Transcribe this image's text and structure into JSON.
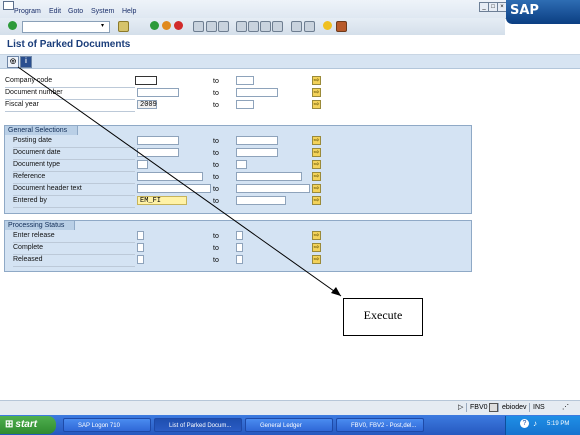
{
  "menu": [
    "Program",
    "Edit",
    "Goto",
    "System",
    "Help"
  ],
  "brand": "SAP",
  "page_title": "List of Parked Documents",
  "top_fields": [
    {
      "label": "Company code",
      "from": "",
      "to_label": "to",
      "to": ""
    },
    {
      "label": "Document number",
      "from": "",
      "to_label": "to",
      "to": ""
    },
    {
      "label": "Fiscal year",
      "from": "2009",
      "to_label": "to",
      "to": ""
    }
  ],
  "general_selections": {
    "title": "General Selections",
    "rows": [
      {
        "label": "Posting date",
        "from": "",
        "to_label": "to",
        "to": ""
      },
      {
        "label": "Document date",
        "from": "",
        "to_label": "to",
        "to": ""
      },
      {
        "label": "Document type",
        "from": "",
        "to_label": "to",
        "to": ""
      },
      {
        "label": "Reference",
        "from": "",
        "to_label": "to",
        "to": ""
      },
      {
        "label": "Document header text",
        "from": "",
        "to_label": "to",
        "to": ""
      },
      {
        "label": "Entered by",
        "from": "EM_FI",
        "to_label": "to",
        "to": ""
      }
    ]
  },
  "processing_status": {
    "title": "Processing Status",
    "rows": [
      {
        "label": "Enter release",
        "to_label": "to"
      },
      {
        "label": "Complete",
        "to_label": "to"
      },
      {
        "label": "Released",
        "to_label": "to"
      }
    ]
  },
  "annotation": {
    "text": "Execute"
  },
  "status_bar": {
    "transaction": "FBV0",
    "server": "ebiodev",
    "mode": "INS"
  },
  "taskbar": {
    "start": "start",
    "items": [
      "SAP Logon 710",
      "List of Parked Docum...",
      "General Ledger",
      "FBV0, FBV2 - Post,del..."
    ],
    "clock": "5:19 PM"
  },
  "colors": {
    "accent": "#1a3d7a",
    "group_bg": "#d4e3f3",
    "multi_select": "#f3d25a",
    "taskbar": "#2658bf"
  }
}
